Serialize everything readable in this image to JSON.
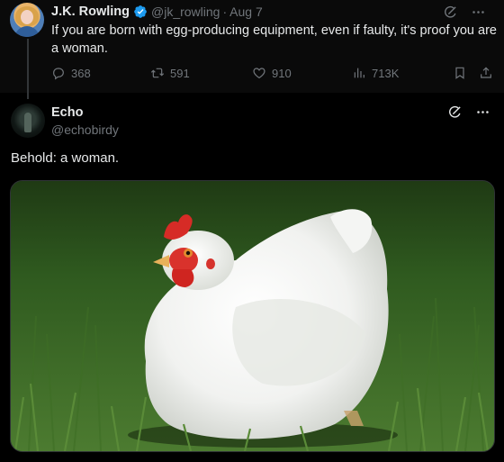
{
  "parent_tweet": {
    "author_name": "J.K. Rowling",
    "author_handle": "@jk_rowling",
    "separator": "·",
    "date": "Aug 7",
    "text": "If you are born with egg-producing equipment, even if faulty, it's proof you are a woman.",
    "stats": {
      "replies": "368",
      "reposts": "591",
      "likes": "910",
      "views": "713K"
    }
  },
  "reply_tweet": {
    "author_name": "Echo",
    "author_handle": "@echobirdy",
    "text": "Behold: a woman.",
    "image": "white-hen-on-grass"
  },
  "colors": {
    "background": "#000000",
    "text_primary": "#e7e9ea",
    "text_secondary": "#71767b",
    "verified_badge": "#1d9bf0"
  }
}
